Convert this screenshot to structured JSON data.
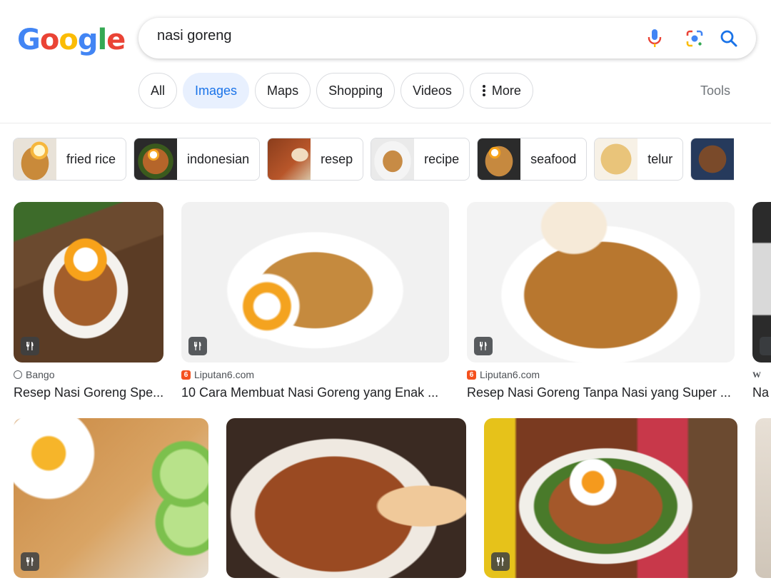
{
  "header": {
    "logo_letters": [
      "G",
      "o",
      "o",
      "g",
      "l",
      "e"
    ],
    "logo_colors": [
      "#4285F4",
      "#EA4335",
      "#FBBC05",
      "#4285F4",
      "#34A853",
      "#EA4335"
    ],
    "query": "nasi goreng"
  },
  "tabs": [
    {
      "label": "All"
    },
    {
      "label": "Images"
    },
    {
      "label": "Maps"
    },
    {
      "label": "Shopping"
    },
    {
      "label": "Videos"
    },
    {
      "label": "More"
    }
  ],
  "tools_label": "Tools",
  "chips": [
    {
      "label": "fried rice"
    },
    {
      "label": "indonesian"
    },
    {
      "label": "resep"
    },
    {
      "label": "recipe"
    },
    {
      "label": "seafood"
    },
    {
      "label": "telur"
    }
  ],
  "results": [
    {
      "source": "Bango",
      "title": "Resep Nasi Goreng Spe..."
    },
    {
      "source": "Liputan6.com",
      "title": "10 Cara Membuat Nasi Goreng yang Enak ..."
    },
    {
      "source": "Liputan6.com",
      "title": "Resep Nasi Goreng Tanpa Nasi yang Super ..."
    },
    {
      "source": "W",
      "title": "Na"
    }
  ],
  "colors": {
    "accent": "#1a73e8",
    "active_tab_bg": "#e8f0fe"
  },
  "icons": [
    "mic-icon",
    "lens-icon",
    "search-icon",
    "more-dots-icon",
    "recipe-fork-knife-icon",
    "globe-icon"
  ]
}
